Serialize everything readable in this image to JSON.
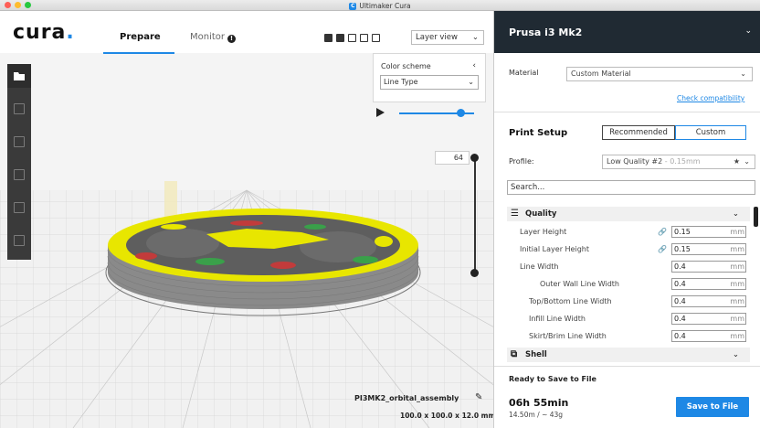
{
  "window": {
    "title": "Ultimaker Cura"
  },
  "header": {
    "logo_text": "cura",
    "logo_dot": ".",
    "tabs": [
      {
        "label": "Prepare",
        "active": true
      },
      {
        "label": "Monitor",
        "active": false
      }
    ],
    "monitor_badge": "!",
    "view_select": "Layer view",
    "chevron": "⌄"
  },
  "color_scheme": {
    "label": "Color scheme",
    "value": "Line Type",
    "collapse": "‹"
  },
  "layer_slider": {
    "value": "64"
  },
  "model": {
    "name": "PI3MK2_orbital_assembly",
    "dimensions": "100.0 x 100.0 x 12.0 mm"
  },
  "panel": {
    "printer": "Prusa i3 Mk2",
    "material_label": "Material",
    "material_value": "Custom Material",
    "check_link": "Check compatibility",
    "print_setup_title": "Print Setup",
    "mode_recommended": "Recommended",
    "mode_custom": "Custom",
    "profile_label": "Profile:",
    "profile_value": "Low Quality #2",
    "profile_sub": " - 0.15mm",
    "search_placeholder": "Search...",
    "categories": [
      {
        "label": "Quality"
      },
      {
        "label": "Shell"
      }
    ],
    "settings": [
      {
        "label": "Layer Height",
        "value": "0.15",
        "unit": "mm",
        "linked": true
      },
      {
        "label": "Initial Layer Height",
        "value": "0.15",
        "unit": "mm",
        "linked": true
      },
      {
        "label": "Line Width",
        "value": "0.4",
        "unit": "mm",
        "linked": false
      },
      {
        "label": "Outer Wall Line Width",
        "value": "0.4",
        "unit": "mm",
        "linked": false
      },
      {
        "label": "Top/Bottom Line Width",
        "value": "0.4",
        "unit": "mm",
        "linked": false
      },
      {
        "label": "Infill Line Width",
        "value": "0.4",
        "unit": "mm",
        "linked": false
      },
      {
        "label": "Skirt/Brim Line Width",
        "value": "0.4",
        "unit": "mm",
        "linked": false
      }
    ],
    "link_icon": "🔗",
    "footer": {
      "status": "Ready to Save to File",
      "time": "06h 55min",
      "material_estimate": "14.50m / ~ 43g",
      "save_label": "Save to File"
    }
  },
  "colors": {
    "accent": "#1e88e5",
    "panel_header": "#202a33",
    "toolbar": "#3a3a3a",
    "infill": "#e8e600",
    "walls": "#888888"
  }
}
